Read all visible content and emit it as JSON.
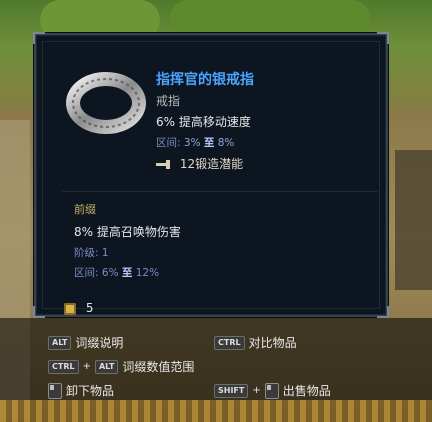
{
  "item": {
    "name": "指挥官的银戒指",
    "type": "戒指",
    "implicit": "6% 提高移动速度",
    "implicit_range_label": "区间:",
    "implicit_min": "3%",
    "implicit_to": "至",
    "implicit_max": "8%",
    "forging_potential": "12锻造潜能",
    "affix_section_title": "前缀",
    "affix_text": "8% 提高召唤物伤害",
    "affix_tier_label": "阶级:",
    "affix_tier_value": "1",
    "affix_range_label": "区间:",
    "affix_min": "6%",
    "affix_to": "至",
    "affix_max": "12%",
    "price": "5",
    "icons": [
      "ring-icon",
      "hammer-icon",
      "gold-coin-icon"
    ],
    "colors": {
      "name": "#4aa3ff",
      "affix_title": "#c7b26c",
      "range": "#7a8cc2"
    }
  },
  "hints": {
    "alt_key": "ALT",
    "affix_explain": "词缀说明",
    "ctrl_key": "CTRL",
    "compare": "对比物品",
    "ctrl_key2": "CTRL",
    "plus1": "+",
    "alt_key2": "ALT",
    "affix_ranges": "词缀数值范围",
    "unequip": "卸下物品",
    "shift_key": "SHIFT",
    "plus2": "+",
    "sell": "出售物品"
  }
}
